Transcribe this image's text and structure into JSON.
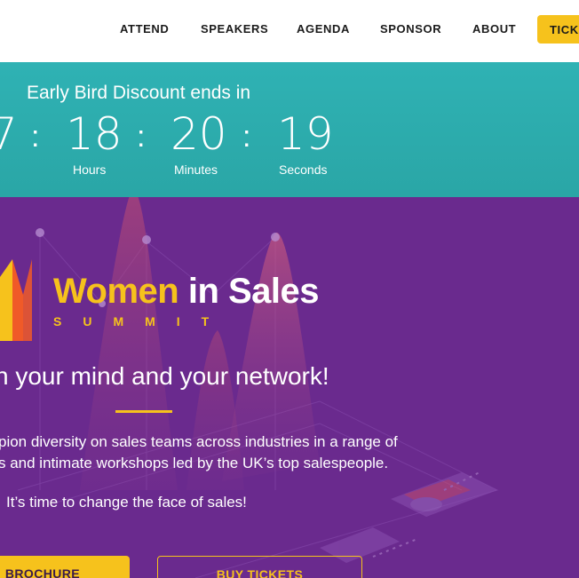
{
  "nav": {
    "items": [
      "ATTEND",
      "SPEAKERS",
      "AGENDA",
      "SPONSOR",
      "ABOUT"
    ],
    "cta_label": "TICK"
  },
  "countdown": {
    "title": "Early Bird Discount ends in",
    "days_value": "7",
    "hours_value": "18",
    "minutes_value": "20",
    "seconds_value": "19",
    "separator": ":",
    "hours_label": "Hours",
    "minutes_label": "Minutes",
    "seconds_label": "Seconds"
  },
  "hero": {
    "logo": {
      "word1": "Women",
      "word2": " in Sales",
      "word3": "SUMMIT"
    },
    "tagline": "n your mind and your network!",
    "description_line1": "pion diversity on sales teams across industries in a range of",
    "description_line2": "s and intimate workshops led by the UK’s top salespeople.",
    "description_line3": "It’s time to change the face of sales!",
    "brochure_label": "BROCHURE",
    "tickets_label": "BUY TICKETS"
  },
  "colors": {
    "accent": "#f6c21c",
    "teal": "#2fb2b4",
    "purple": "#6a2a8e",
    "logo_orange": "#f05a28"
  },
  "icons": [
    "women-in-sales-logo-mark"
  ]
}
